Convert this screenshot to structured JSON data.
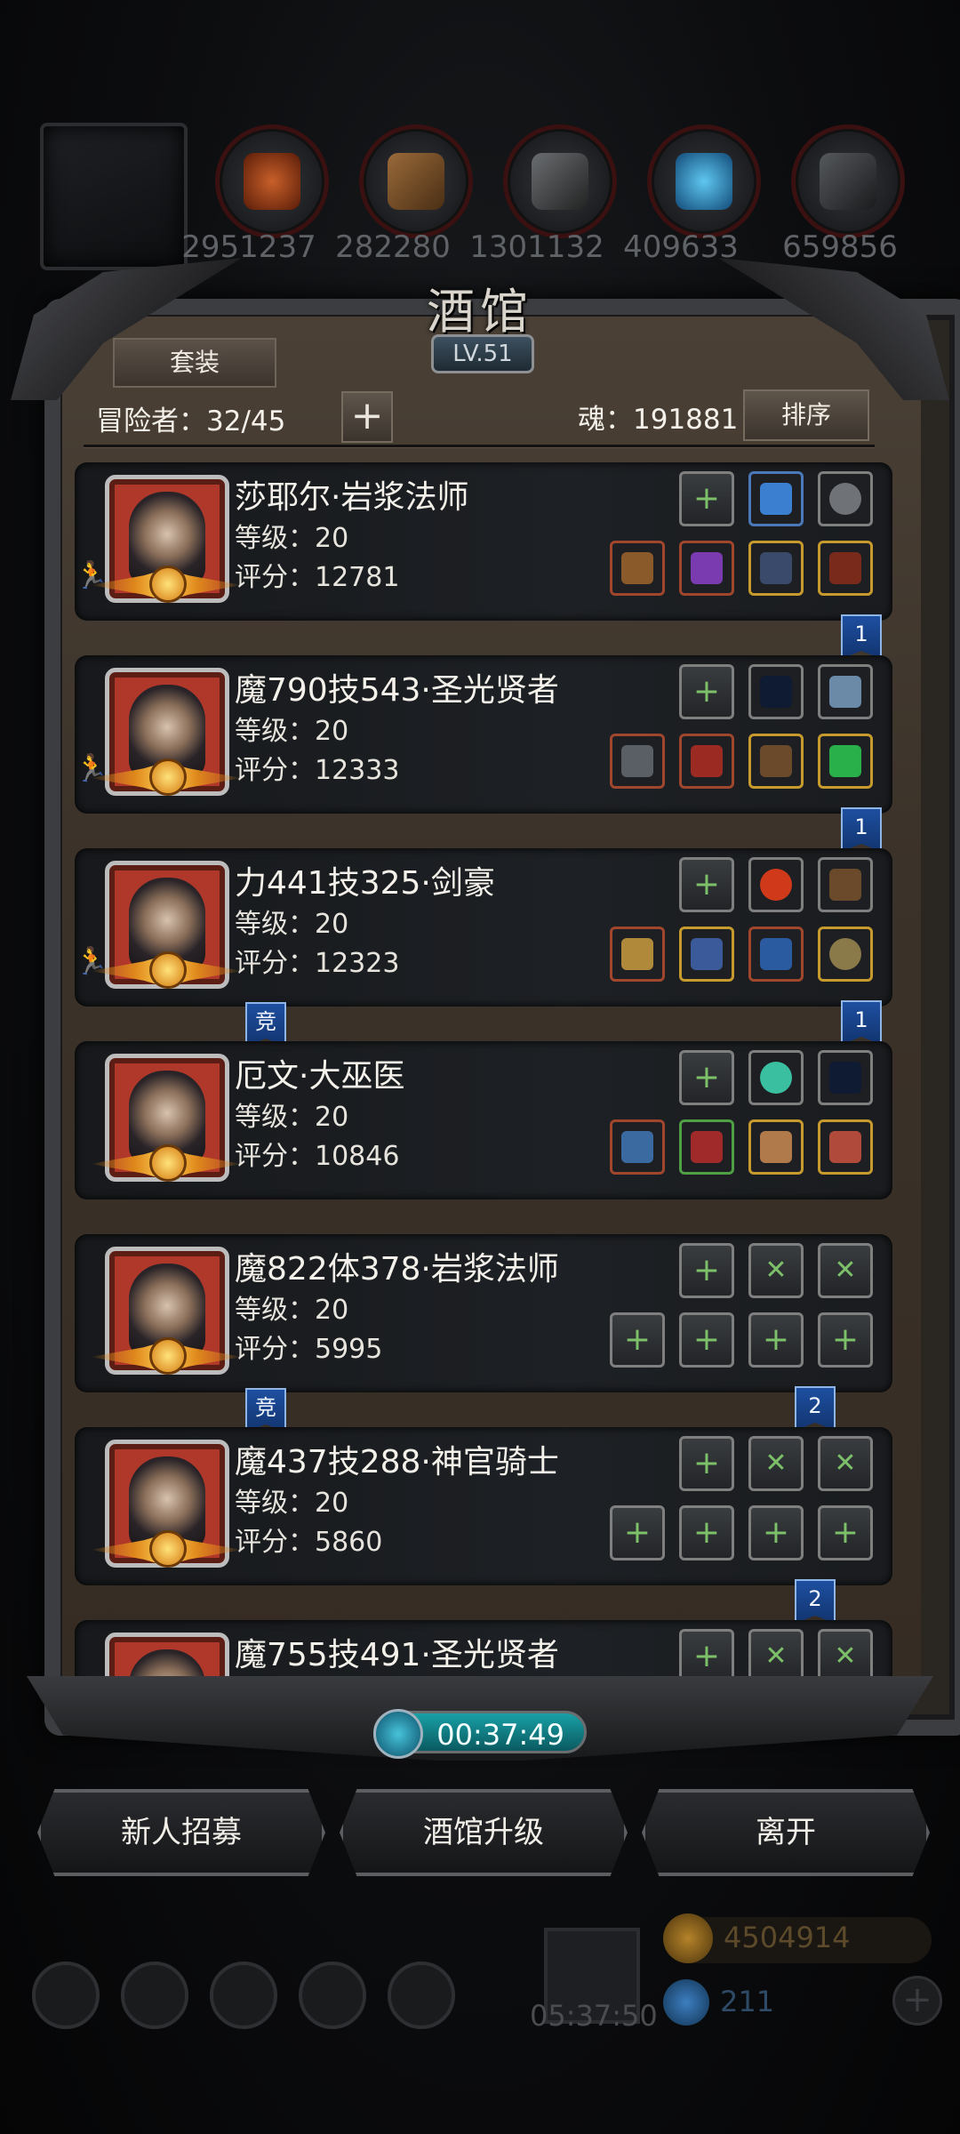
{
  "resources": [
    {
      "icon": "meat-icon",
      "value": "2951237"
    },
    {
      "icon": "wood-icon",
      "value": "282280"
    },
    {
      "icon": "iron-icon",
      "value": "1301132"
    },
    {
      "icon": "crystal-icon",
      "value": "409633"
    },
    {
      "icon": "stone-icon",
      "value": "659856"
    }
  ],
  "panel": {
    "title": "酒馆",
    "level": "LV.51",
    "suit_button": "套装",
    "adventurers": "冒险者：32/45",
    "soul": "魂：191881",
    "sort_button": "排序"
  },
  "heroes": [
    {
      "name": "莎耶尔·岩浆法师",
      "level": "等级：20",
      "score": "评分：12781",
      "tags": [
        "1"
      ],
      "comp": ""
    },
    {
      "name": "魔790技543·圣光贤者",
      "level": "等级：20",
      "score": "评分：12333",
      "tags": [
        "1"
      ],
      "comp": ""
    },
    {
      "name": "力441技325·剑豪",
      "level": "等级：20",
      "score": "评分：12323",
      "tags": [
        "1"
      ],
      "comp": "竞"
    },
    {
      "name": "厄文·大巫医",
      "level": "等级：20",
      "score": "评分：10846",
      "tags": [],
      "comp": ""
    },
    {
      "name": "魔822体378·岩浆法师",
      "level": "等级：20",
      "score": "评分：5995",
      "tags": [
        "2"
      ],
      "comp": "竞"
    },
    {
      "name": "魔437技288·神官骑士",
      "level": "等级：20",
      "score": "评分：5860",
      "tags": [
        "2"
      ],
      "comp": ""
    },
    {
      "name": "魔755技491·圣光贤者",
      "level": "",
      "score": "",
      "tags": [],
      "comp": ""
    }
  ],
  "timer": "00:37:49",
  "actions": {
    "recruit": "新人招募",
    "upgrade": "酒馆升级",
    "leave": "离开"
  },
  "bottom": {
    "gift_timer": "05:37:50",
    "gold": "4504914",
    "gems": "211"
  },
  "colors": {
    "timer": "#18a0a6",
    "badge": "#1e4fa0",
    "portrait_bg": "#b0382a"
  }
}
